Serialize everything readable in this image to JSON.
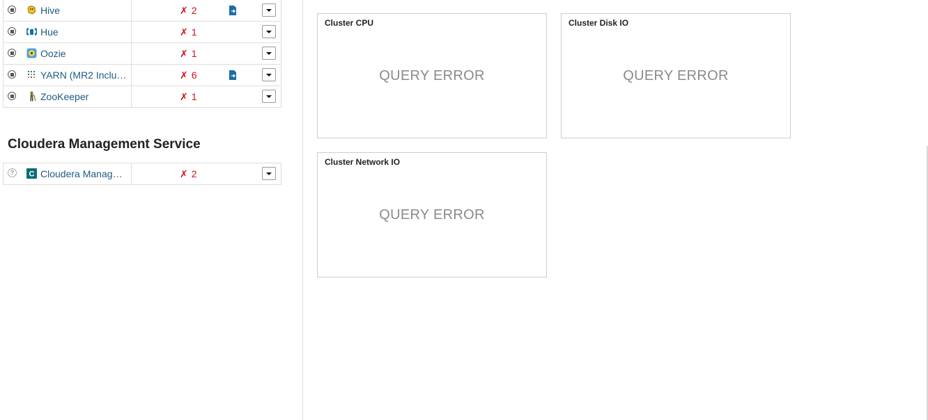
{
  "services": [
    {
      "name": "Hive",
      "icon": "hive-icon",
      "health_count": "2",
      "has_config_alert": true
    },
    {
      "name": "Hue",
      "icon": "hue-icon",
      "health_count": "1",
      "has_config_alert": false
    },
    {
      "name": "Oozie",
      "icon": "oozie-icon",
      "health_count": "1",
      "has_config_alert": false
    },
    {
      "name": "YARN (MR2 Inclu…",
      "icon": "yarn-icon",
      "health_count": "6",
      "has_config_alert": true
    },
    {
      "name": "ZooKeeper",
      "icon": "zookeeper-icon",
      "health_count": "1",
      "has_config_alert": false
    }
  ],
  "management": {
    "section_title": "Cloudera Management Service",
    "service": {
      "name": "Cloudera Manag…",
      "icon": "cloudera-c-icon",
      "health_count": "2",
      "status": "unknown"
    }
  },
  "charts": [
    {
      "title": "Cluster CPU",
      "message": "QUERY ERROR"
    },
    {
      "title": "Cluster Disk IO",
      "message": "QUERY ERROR"
    },
    {
      "title": "Cluster Network IO",
      "message": "QUERY ERROR"
    }
  ],
  "colors": {
    "link": "#1f5a82",
    "health_bad": "#d0101a",
    "config_icon": "#1c6ea4",
    "error_text": "#8a8a8a"
  }
}
